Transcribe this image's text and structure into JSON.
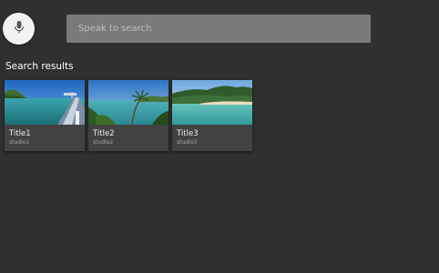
{
  "voice_button": {
    "icon": "mic-icon"
  },
  "search": {
    "placeholder": "Speak to search",
    "value": ""
  },
  "results": {
    "title": "Search results",
    "items": [
      {
        "title": "Title1",
        "subtitle": "studio1",
        "image": "beach-pier-photo"
      },
      {
        "title": "Title2",
        "subtitle": "studio2",
        "image": "beach-palm-photo"
      },
      {
        "title": "Title3",
        "subtitle": "studio3",
        "image": "island-beach-photo"
      }
    ]
  },
  "colors": {
    "background": "#303030",
    "card": "#424242",
    "search_bar": "#7a7a7a",
    "mic_button": "#f2f2f2"
  }
}
